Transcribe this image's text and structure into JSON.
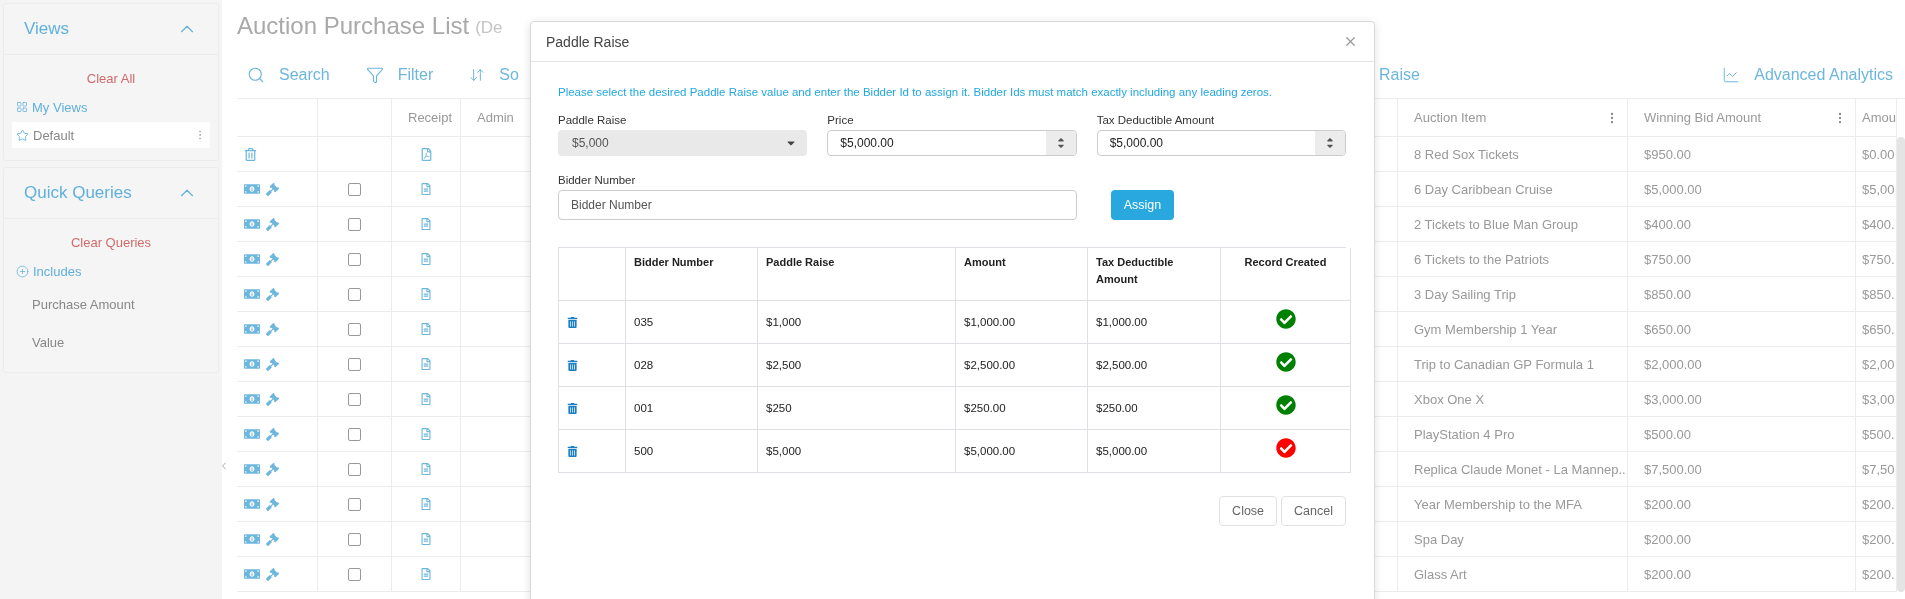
{
  "sidebar": {
    "panels": [
      {
        "title": "Views",
        "expanded": true,
        "clear": "Clear All",
        "items": [
          {
            "kind": "group",
            "label": "My Views",
            "selected": false
          },
          {
            "kind": "view",
            "label": "Default",
            "selected": true
          }
        ]
      },
      {
        "title": "Quick Queries",
        "expanded": true,
        "clear": "Clear Queries",
        "items": [
          {
            "kind": "add",
            "label": "Includes",
            "selected": false
          },
          {
            "kind": "field",
            "label": "Purchase Amount",
            "selected": false
          },
          {
            "kind": "field",
            "label": "Value",
            "selected": false
          }
        ]
      }
    ]
  },
  "page": {
    "title": "Auction Purchase List",
    "subtitle": "(De",
    "toolbar": [
      {
        "kind": "search",
        "label": "Search"
      },
      {
        "kind": "filter",
        "label": "Filter"
      },
      {
        "kind": "sort",
        "label": "So"
      }
    ],
    "toolbar_right": {
      "label": "Raise"
    },
    "analytics": "Advanced Analytics"
  },
  "table": {
    "columns": {
      "receipt": "Receipt",
      "admin": "Admin",
      "item": "Auction Item",
      "bid": "Winning Bid Amount",
      "amount": "Amou"
    },
    "rows": [
      {
        "kind": "summary",
        "item": "8 Red Sox Tickets",
        "bid": "$950.00",
        "amount": "$0.00"
      },
      {
        "kind": "item",
        "checked": false,
        "item": "6 Day Caribbean Cruise",
        "bid": "$5,000.00",
        "amount": "$5,00"
      },
      {
        "kind": "item",
        "checked": false,
        "item": "2 Tickets to Blue Man Group",
        "bid": "$400.00",
        "amount": "$400."
      },
      {
        "kind": "item",
        "checked": false,
        "item": "6 Tickets to the Patriots",
        "bid": "$750.00",
        "amount": "$750."
      },
      {
        "kind": "item",
        "checked": false,
        "item": "3 Day Sailing Trip",
        "bid": "$850.00",
        "amount": "$850."
      },
      {
        "kind": "item",
        "checked": false,
        "item": "Gym Membership 1 Year",
        "bid": "$650.00",
        "amount": "$650."
      },
      {
        "kind": "item",
        "checked": false,
        "item": "Trip to Canadian GP Formula 1",
        "bid": "$2,000.00",
        "amount": "$2,00"
      },
      {
        "kind": "item",
        "checked": false,
        "item": "Xbox One X",
        "bid": "$3,000.00",
        "amount": "$3,00"
      },
      {
        "kind": "item",
        "checked": false,
        "item": "PlayStation 4 Pro",
        "bid": "$500.00",
        "amount": "$500."
      },
      {
        "kind": "item",
        "checked": false,
        "item": "Replica Claude Monet - La Mannep...",
        "bid": "$7,500.00",
        "amount": "$7,50"
      },
      {
        "kind": "item",
        "checked": false,
        "item": "Year Membership to the MFA",
        "bid": "$200.00",
        "amount": "$200."
      },
      {
        "kind": "item",
        "checked": false,
        "item": "Spa Day",
        "bid": "$200.00",
        "amount": "$200."
      },
      {
        "kind": "item",
        "checked": false,
        "item": "Glass Art",
        "bid": "$200.00",
        "amount": "$200."
      }
    ]
  },
  "modal": {
    "title": "Paddle Raise",
    "notice": "Please select the desired Paddle Raise value and enter the Bidder Id to assign it. Bidder Ids must match exactly including any leading zeros.",
    "paddle_raise": {
      "label": "Paddle Raise",
      "value": "$5,000",
      "disabled": true
    },
    "price": {
      "label": "Price",
      "value": "$5,000.00"
    },
    "tax": {
      "label": "Tax Deductible Amount",
      "value": "$5,000.00"
    },
    "bidder": {
      "label": "Bidder Number",
      "placeholder": "Bidder Number"
    },
    "assign": "Assign",
    "columns": {
      "bidder": "Bidder Number",
      "paddle": "Paddle Raise",
      "amount": "Amount",
      "tax": "Tax Deductible Amount",
      "record": "Record Created"
    },
    "rows": [
      {
        "bidder": "035",
        "paddle": "$1,000",
        "amount": "$1,000.00",
        "tax": "$1,000.00",
        "color": "#008000"
      },
      {
        "bidder": "028",
        "paddle": "$2,500",
        "amount": "$2,500.00",
        "tax": "$2,500.00",
        "color": "#008000"
      },
      {
        "bidder": "001",
        "paddle": "$250",
        "amount": "$250.00",
        "tax": "$250.00",
        "color": "#008000"
      },
      {
        "bidder": "500",
        "paddle": "$5,000",
        "amount": "$5,000.00",
        "tax": "$5,000.00",
        "color": "#ff0000"
      }
    ],
    "buttons": [
      "Close",
      "Cancel"
    ]
  }
}
